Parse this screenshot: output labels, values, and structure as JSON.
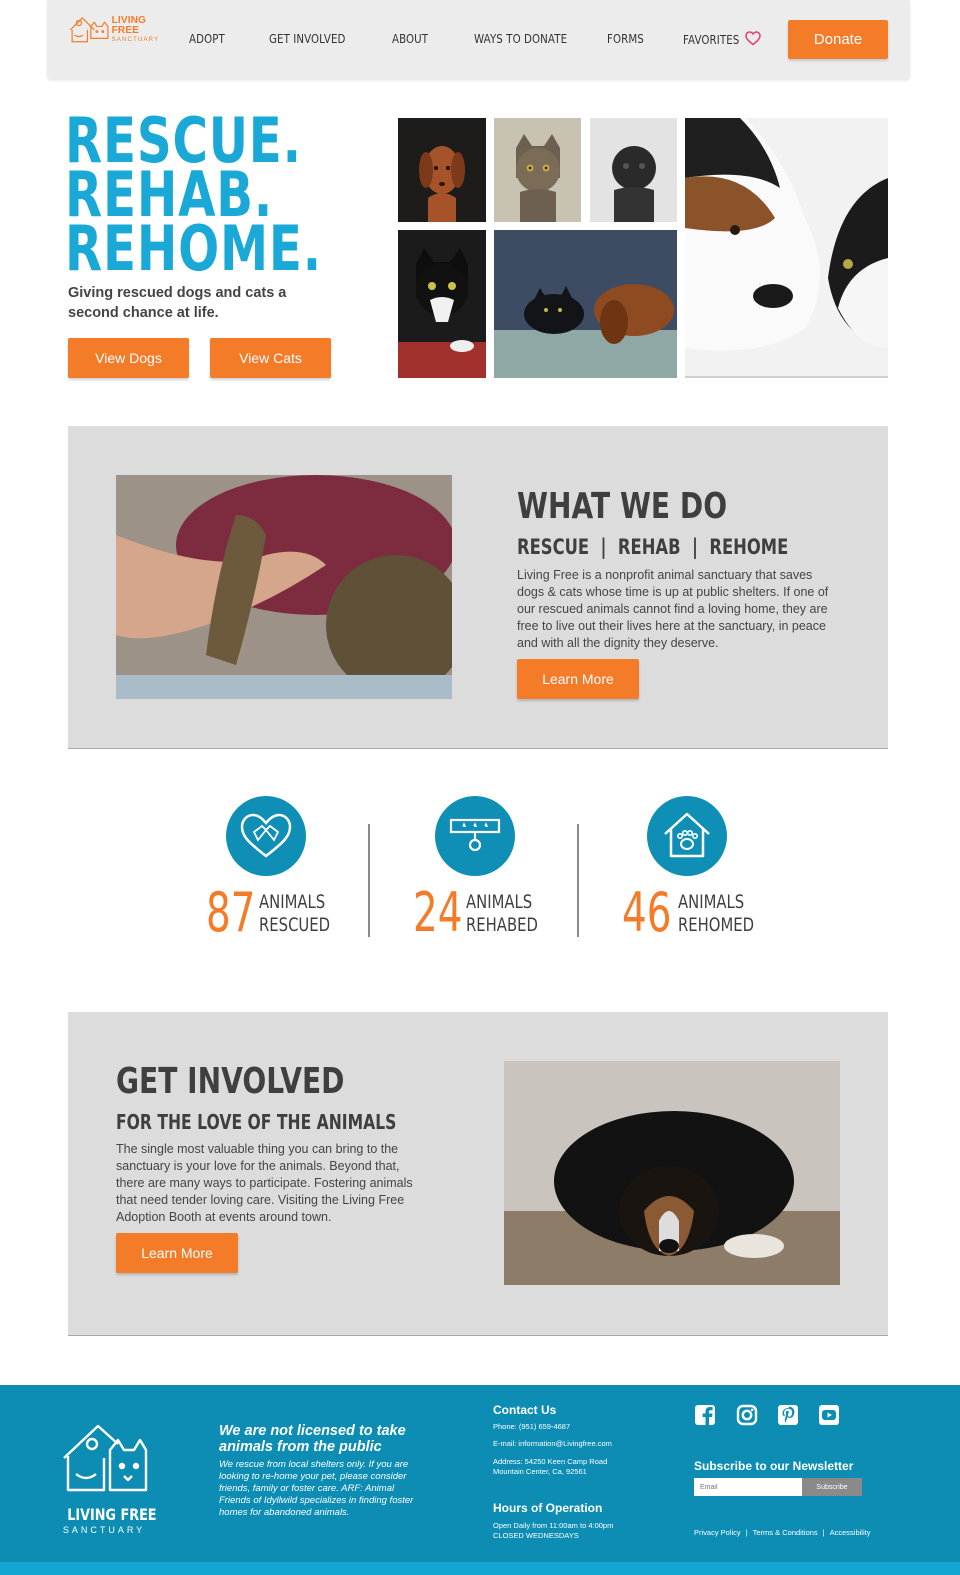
{
  "nav": {
    "logo": {
      "line1": "LIVING FREE",
      "line2": "SANCTUARY"
    },
    "items": [
      {
        "label": "ADOPT"
      },
      {
        "label": "GET INVOLVED"
      },
      {
        "label": "ABOUT"
      },
      {
        "label": "WAYS TO DONATE"
      },
      {
        "label": "FORMS"
      },
      {
        "label": "FAVORITES",
        "icon": "heart-icon"
      }
    ],
    "donate_label": "Donate"
  },
  "hero": {
    "title_lines": [
      "RESCUE.",
      "REHAB.",
      "REHOME."
    ],
    "subtitle": "Giving rescued dogs and cats a second chance at life.",
    "view_dogs_label": "View Dogs",
    "view_cats_label": "View Cats"
  },
  "what_we_do": {
    "title": "WHAT WE DO",
    "subtitle": "RESCUE  |  REHAB  |  REHOME",
    "body": "Living Free is a nonprofit animal sanctuary that saves dogs & cats whose time is up at public shelters. If one of our rescued animals cannot find a loving home, they are free to live out their lives here at the sanctuary, in peace and with all the dignity they deserve.",
    "button_label": "Learn More"
  },
  "stats": [
    {
      "number": "87",
      "line1": "ANIMALS",
      "line2": "RESCUED",
      "icon": "heart-hands-icon"
    },
    {
      "number": "24",
      "line1": "ANIMALS",
      "line2": "REHABED",
      "icon": "medical-tag-icon"
    },
    {
      "number": "46",
      "line1": "ANIMALS",
      "line2": "REHOMED",
      "icon": "paw-house-icon"
    }
  ],
  "get_involved": {
    "title": "GET INVOLVED",
    "subtitle": "FOR THE LOVE OF THE ANIMALS",
    "body": "The single most valuable thing you can bring to the sanctuary is your love for the animals. Beyond that, there are many ways to participate. Fostering animals that need tender loving care. Visiting the Living Free Adoption Booth at events around town.",
    "button_label": "Learn More"
  },
  "footer": {
    "logo": {
      "line1": "LIVING FREE",
      "line2": "SANCTUARY"
    },
    "notice_heading": "We are not licensed to take animals from the public",
    "notice_body": "We rescue from local shelters only. If you are looking to re-home your pet, please consider friends, family or foster care. ARF: Animal Friends of Idyllwild specializes in finding foster homes for abandoned animals.",
    "contact_heading": "Contact Us",
    "phone": "Phone: (951) 659-4687",
    "email": "E-mail: information@Livingfree.com",
    "address_line1": "Address: 54250 Keen Camp Road",
    "address_line2": "Mountain Center, Ca, 92561",
    "hours_heading": "Hours of Operation",
    "hours_line1": "Open Daily from 11:00am to 4:00pm",
    "hours_line2": "CLOSED WEDNESDAYS",
    "social": [
      "facebook-icon",
      "instagram-icon",
      "pinterest-icon",
      "youtube-icon"
    ],
    "newsletter_heading": "Subscribe to our Newsletter",
    "email_placeholder": "Email",
    "subscribe_label": "Subscribe",
    "links": [
      "Privacy Policy",
      "Terms & Conditions",
      "Accessibility"
    ]
  },
  "colors": {
    "accent_orange": "#f47b27",
    "brand_blue": "#1aa9d6",
    "footer_blue": "#0d8db4",
    "panel_grey": "#dcdcdc"
  }
}
